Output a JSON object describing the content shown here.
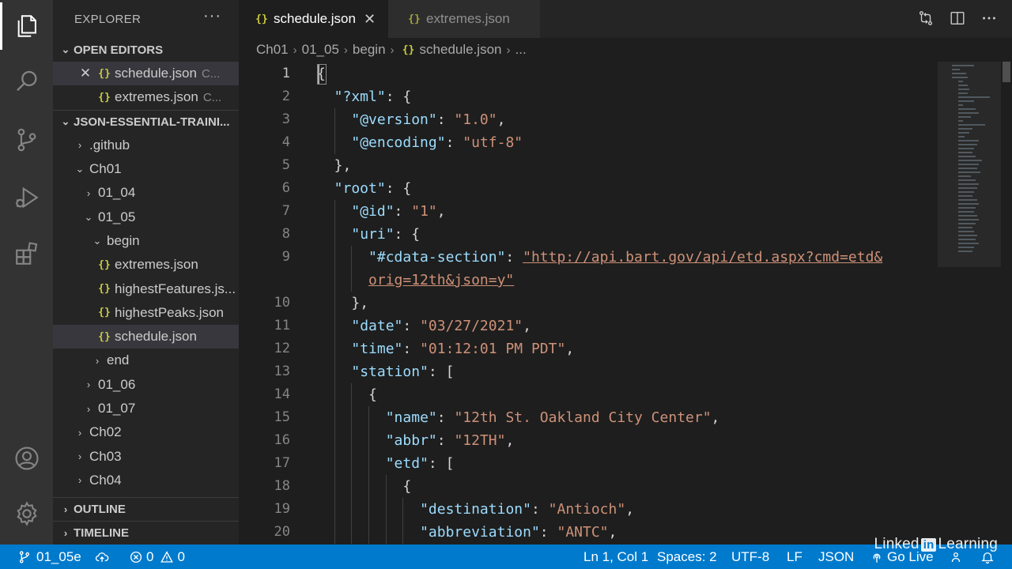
{
  "activity_bar": {
    "items": [
      "explorer-icon",
      "search-icon",
      "source-control-icon",
      "run-debug-icon",
      "extensions-icon"
    ],
    "bottom": [
      "account-icon",
      "settings-gear-icon"
    ]
  },
  "sidebar": {
    "title": "EXPLORER",
    "more": "···",
    "open_editors_label": "OPEN EDITORS",
    "open_editors": [
      {
        "name": "schedule.json",
        "dir": "C..."
      },
      {
        "name": "extremes.json",
        "dir": "C..."
      }
    ],
    "workspace_label": "JSON-ESSENTIAL-TRAINI...",
    "tree": [
      {
        "label": ".github",
        "type": "folder",
        "depth": 1,
        "open": false
      },
      {
        "label": "Ch01",
        "type": "folder",
        "depth": 1,
        "open": true
      },
      {
        "label": "01_04",
        "type": "folder",
        "depth": 2,
        "open": false
      },
      {
        "label": "01_05",
        "type": "folder",
        "depth": 2,
        "open": true
      },
      {
        "label": "begin",
        "type": "folder",
        "depth": 3,
        "open": true
      },
      {
        "label": "extremes.json",
        "type": "json",
        "depth": 4
      },
      {
        "label": "highestFeatures.js...",
        "type": "json",
        "depth": 4
      },
      {
        "label": "highestPeaks.json",
        "type": "json",
        "depth": 4
      },
      {
        "label": "schedule.json",
        "type": "json",
        "depth": 4,
        "selected": true
      },
      {
        "label": "end",
        "type": "folder",
        "depth": 3,
        "open": false
      },
      {
        "label": "01_06",
        "type": "folder",
        "depth": 2,
        "open": false
      },
      {
        "label": "01_07",
        "type": "folder",
        "depth": 2,
        "open": false
      },
      {
        "label": "Ch02",
        "type": "folder",
        "depth": 1,
        "open": false
      },
      {
        "label": "Ch03",
        "type": "folder",
        "depth": 1,
        "open": false
      },
      {
        "label": "Ch04",
        "type": "folder",
        "depth": 1,
        "open": false
      }
    ],
    "outline_label": "OUTLINE",
    "timeline_label": "TIMELINE"
  },
  "tabs": [
    {
      "label": "schedule.json",
      "active": true
    },
    {
      "label": "extremes.json",
      "active": false
    }
  ],
  "breadcrumb": [
    "Ch01",
    "01_05",
    "begin",
    "schedule.json",
    "..."
  ],
  "editor": {
    "lines": [
      {
        "n": "1",
        "indent": 0,
        "tokens": [
          {
            "t": "{",
            "c": "p"
          }
        ]
      },
      {
        "n": "2",
        "indent": 1,
        "tokens": [
          {
            "t": "\"?xml\"",
            "c": "k"
          },
          {
            "t": ": {",
            "c": "p"
          }
        ]
      },
      {
        "n": "3",
        "indent": 2,
        "tokens": [
          {
            "t": "\"@version\"",
            "c": "k"
          },
          {
            "t": ": ",
            "c": "p"
          },
          {
            "t": "\"1.0\"",
            "c": "s"
          },
          {
            "t": ",",
            "c": "p"
          }
        ]
      },
      {
        "n": "4",
        "indent": 2,
        "tokens": [
          {
            "t": "\"@encoding\"",
            "c": "k"
          },
          {
            "t": ": ",
            "c": "p"
          },
          {
            "t": "\"utf-8\"",
            "c": "s"
          }
        ]
      },
      {
        "n": "5",
        "indent": 1,
        "tokens": [
          {
            "t": "},",
            "c": "p"
          }
        ]
      },
      {
        "n": "6",
        "indent": 1,
        "tokens": [
          {
            "t": "\"root\"",
            "c": "k"
          },
          {
            "t": ": {",
            "c": "p"
          }
        ]
      },
      {
        "n": "7",
        "indent": 2,
        "tokens": [
          {
            "t": "\"@id\"",
            "c": "k"
          },
          {
            "t": ": ",
            "c": "p"
          },
          {
            "t": "\"1\"",
            "c": "s"
          },
          {
            "t": ",",
            "c": "p"
          }
        ]
      },
      {
        "n": "8",
        "indent": 2,
        "tokens": [
          {
            "t": "\"uri\"",
            "c": "k"
          },
          {
            "t": ": {",
            "c": "p"
          }
        ]
      },
      {
        "n": "9",
        "indent": 3,
        "tokens": [
          {
            "t": "\"#cdata-section\"",
            "c": "k"
          },
          {
            "t": ": ",
            "c": "p"
          },
          {
            "t": "\"http://api.bart.gov/api/etd.aspx?cmd=etd&",
            "c": "u"
          }
        ]
      },
      {
        "n": "",
        "indent": 3,
        "tokens": [
          {
            "t": "orig=12th&json=y\"",
            "c": "u"
          }
        ]
      },
      {
        "n": "10",
        "indent": 2,
        "tokens": [
          {
            "t": "},",
            "c": "p"
          }
        ]
      },
      {
        "n": "11",
        "indent": 2,
        "tokens": [
          {
            "t": "\"date\"",
            "c": "k"
          },
          {
            "t": ": ",
            "c": "p"
          },
          {
            "t": "\"03/27/2021\"",
            "c": "s"
          },
          {
            "t": ",",
            "c": "p"
          }
        ]
      },
      {
        "n": "12",
        "indent": 2,
        "tokens": [
          {
            "t": "\"time\"",
            "c": "k"
          },
          {
            "t": ": ",
            "c": "p"
          },
          {
            "t": "\"01:12:01 PM PDT\"",
            "c": "s"
          },
          {
            "t": ",",
            "c": "p"
          }
        ]
      },
      {
        "n": "13",
        "indent": 2,
        "tokens": [
          {
            "t": "\"station\"",
            "c": "k"
          },
          {
            "t": ": [",
            "c": "p"
          }
        ]
      },
      {
        "n": "14",
        "indent": 3,
        "tokens": [
          {
            "t": "{",
            "c": "p"
          }
        ]
      },
      {
        "n": "15",
        "indent": 4,
        "tokens": [
          {
            "t": "\"name\"",
            "c": "k"
          },
          {
            "t": ": ",
            "c": "p"
          },
          {
            "t": "\"12th St. Oakland City Center\"",
            "c": "s"
          },
          {
            "t": ",",
            "c": "p"
          }
        ]
      },
      {
        "n": "16",
        "indent": 4,
        "tokens": [
          {
            "t": "\"abbr\"",
            "c": "k"
          },
          {
            "t": ": ",
            "c": "p"
          },
          {
            "t": "\"12TH\"",
            "c": "s"
          },
          {
            "t": ",",
            "c": "p"
          }
        ]
      },
      {
        "n": "17",
        "indent": 4,
        "tokens": [
          {
            "t": "\"etd\"",
            "c": "k"
          },
          {
            "t": ": [",
            "c": "p"
          }
        ]
      },
      {
        "n": "18",
        "indent": 5,
        "tokens": [
          {
            "t": "{",
            "c": "p"
          }
        ]
      },
      {
        "n": "19",
        "indent": 6,
        "tokens": [
          {
            "t": "\"destination\"",
            "c": "k"
          },
          {
            "t": ": ",
            "c": "p"
          },
          {
            "t": "\"Antioch\"",
            "c": "s"
          },
          {
            "t": ",",
            "c": "p"
          }
        ]
      },
      {
        "n": "20",
        "indent": 6,
        "tokens": [
          {
            "t": "\"abbreviation\"",
            "c": "k"
          },
          {
            "t": ": ",
            "c": "p"
          },
          {
            "t": "\"ANTC\"",
            "c": "s"
          },
          {
            "t": ",",
            "c": "p"
          }
        ]
      }
    ]
  },
  "status_bar": {
    "branch": "01_05e",
    "errors": "0",
    "warnings": "0",
    "cursor": "Ln 1, Col 1",
    "spaces": "Spaces: 2",
    "encoding": "UTF-8",
    "eol": "LF",
    "language": "JSON",
    "go_live": "Go Live"
  },
  "watermark": {
    "pre": "Linked",
    "in": "in",
    "post": "Learning"
  },
  "colors": {
    "accent": "#007acc",
    "json_icon": "#cbcb41",
    "key": "#9cdcfe",
    "string": "#ce9178"
  }
}
